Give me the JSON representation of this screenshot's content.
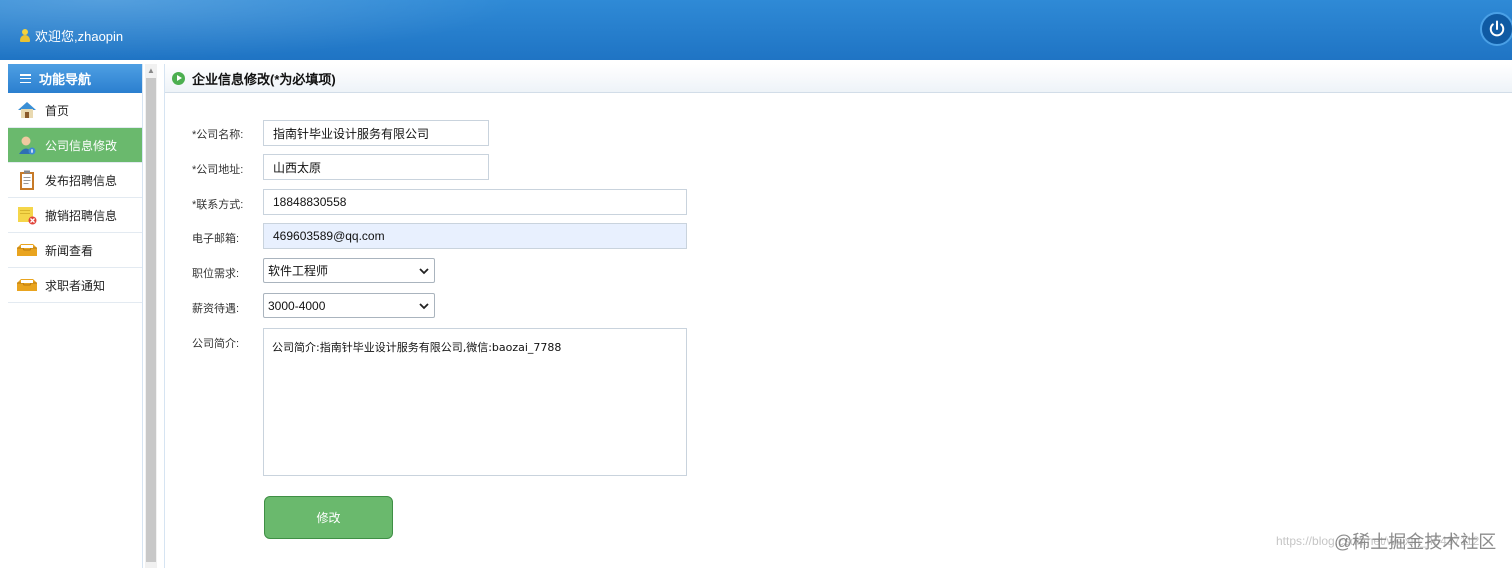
{
  "header": {
    "welcome": "欢迎您,zhaopin",
    "accent": "#2a7fcf"
  },
  "sidebar": {
    "title": "功能导航",
    "items": [
      {
        "label": "首页",
        "icon": "home-icon"
      },
      {
        "label": "公司信息修改",
        "icon": "user-info-icon",
        "active": true
      },
      {
        "label": "发布招聘信息",
        "icon": "clipboard-icon"
      },
      {
        "label": "撤销招聘信息",
        "icon": "note-delete-icon"
      },
      {
        "label": "新闻查看",
        "icon": "inbox-icon"
      },
      {
        "label": "求职者通知",
        "icon": "inbox-icon"
      }
    ],
    "active_color": "#6ab96d"
  },
  "main": {
    "title": "企业信息修改(*为必填项)",
    "form": {
      "company_name_label": "*公司名称:",
      "company_name_value": "指南针毕业设计服务有限公司",
      "address_label": "*公司地址:",
      "address_value": "山西太原",
      "contact_label": "*联系方式:",
      "contact_value": "18848830558",
      "email_label": "电子邮箱:",
      "email_value": "469603589@qq.com",
      "position_label": "职位需求:",
      "position_value": "软件工程师",
      "salary_label": "薪资待遇:",
      "salary_value": "3000-4000",
      "intro_label": "公司简介:",
      "intro_value": "公司简介:指南针毕业设计服务有限公司,微信:baozai_7788",
      "submit_label": "修改"
    }
  },
  "watermark": {
    "url": "https://blog.csdn.net/weixin_46437112",
    "brand": "@稀土掘金技术社区"
  }
}
